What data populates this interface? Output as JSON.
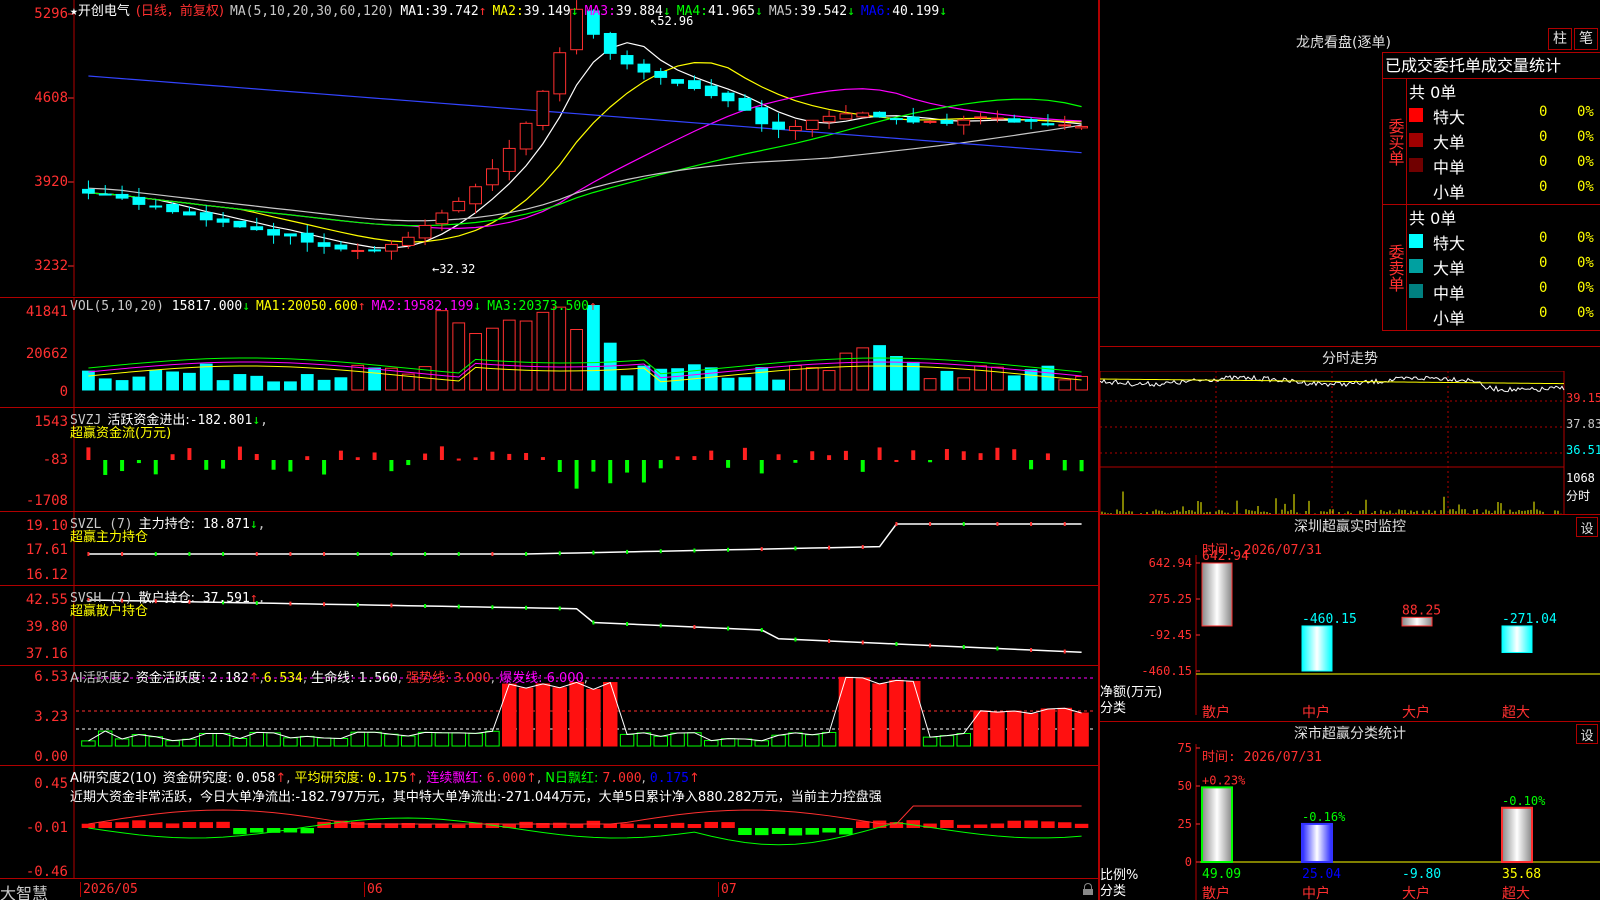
{
  "stock": {
    "star": "★",
    "name": "开创电气",
    "period": "(日线，前复权)"
  },
  "kline": {
    "ma_params": "MA(5,10,20,30,60,120)",
    "ma": [
      {
        "label": "MA1:",
        "value": "39.742",
        "arrow": "↑",
        "color": "#ffffff"
      },
      {
        "label": "MA2:",
        "value": "39.149",
        "arrow": "↓",
        "color": "#ffff00"
      },
      {
        "label": "MA3:",
        "value": "39.884",
        "arrow": "↓",
        "color": "#ff00ff"
      },
      {
        "label": "MA4:",
        "value": "41.965",
        "arrow": "↓",
        "color": "#00ff00"
      },
      {
        "label": "MA5:",
        "value": "39.542",
        "arrow": "↓",
        "color": "#c8c8c8"
      },
      {
        "label": "MA6:",
        "value": "40.199",
        "arrow": "↓",
        "color": "#0000ff"
      }
    ],
    "yaxis": [
      "5296",
      "4608",
      "3920",
      "3232"
    ],
    "high_mark": "52.96",
    "low_mark": "32.32"
  },
  "vol": {
    "title": "VOL(5,10,20)",
    "value": "15817.000",
    "arrow": "↓",
    "ma": [
      {
        "label": "MA1:",
        "value": "20050.600",
        "arrow": "↑",
        "color": "#ffff00"
      },
      {
        "label": "MA2:",
        "value": "19582.199",
        "arrow": "↓",
        "color": "#ff00ff"
      },
      {
        "label": "MA3:",
        "value": "20373.500",
        "arrow": "↑",
        "color": "#00ff00"
      }
    ],
    "yaxis": [
      "41841",
      "20662",
      "0"
    ]
  },
  "svzj": {
    "title": "SVZJ",
    "label": "活跃资金进出:",
    "value": "-182.801",
    "arrow": "↓",
    "sub": "超赢资金流(万元)",
    "yaxis": [
      "1543",
      "-83",
      "-1708"
    ]
  },
  "svzl": {
    "title": "SVZL (7)",
    "label": "主力持仓:",
    "value": "18.871",
    "arrow": "↓",
    "sub": "超赢主力持仓",
    "yaxis": [
      "19.10",
      "17.61",
      "16.12"
    ]
  },
  "svsh": {
    "title": "SVSH (7)",
    "label": "散户持仓:",
    "value": "37.591",
    "arrow": "↑",
    "sub": "超赢散户持仓",
    "yaxis": [
      "42.55",
      "39.80",
      "37.16"
    ]
  },
  "ai1": {
    "title": "AI活跃度2",
    "label": "资金活跃度:",
    "value": "2.182",
    "arrow": "↑",
    "v2": "6.534",
    "life_label": "生命线:",
    "life": "1.560",
    "strong": "强势线: 3.000",
    "burst": "爆发线: 6.000",
    "yaxis": [
      "6.53",
      "3.23",
      "0.00"
    ]
  },
  "ai2": {
    "title": "AI研究度2(10)",
    "label": "资金研究度:",
    "value": "0.058",
    "arrow": "↑",
    "avg_label": "平均研究度:",
    "avg": "0.175",
    "avg_arrow": "↑",
    "cont_label": "连续飘红:",
    "cont": "6.000",
    "cont_arrow": "↑",
    "nday_label": "N日飘红:",
    "nday": "7.000",
    "tail": "0.175",
    "tail_arrow": "↑",
    "comment": "近期大资金非常活跃，今日大单净流出:-182.797万元，其中特大单净流出:-271.044万元，大单5日累计净入880.282万元，当前主力控盘强",
    "yaxis": [
      "0.45",
      "-0.01",
      "-0.46"
    ]
  },
  "xaxis": {
    "logo": "大智慧",
    "labels": [
      "2026/05",
      "06",
      "07"
    ]
  },
  "right": {
    "lhb": {
      "title": "龙虎看盘(逐单)",
      "btn1": "柱",
      "btn2": "笔",
      "header": "已成交委托单成交量统计",
      "buy": {
        "label": "委买单",
        "total": "共 0单",
        "rows": [
          {
            "name": "特大",
            "color": "#ff0000",
            "v": "0",
            "p": "0%"
          },
          {
            "name": "大单",
            "color": "#a00000",
            "v": "0",
            "p": "0%"
          },
          {
            "name": "中单",
            "color": "#700000",
            "v": "0",
            "p": "0%"
          },
          {
            "name": "小单",
            "color": "#000000",
            "v": "0",
            "p": "0%"
          }
        ]
      },
      "sell": {
        "label": "委卖单",
        "total": "共 0单",
        "rows": [
          {
            "name": "特大",
            "color": "#00ffff",
            "v": "0",
            "p": "0%"
          },
          {
            "name": "大单",
            "color": "#00a0a0",
            "v": "0",
            "p": "0%"
          },
          {
            "name": "中单",
            "color": "#008080",
            "v": "0",
            "p": "0%"
          },
          {
            "name": "小单",
            "color": "#000000",
            "v": "0",
            "p": "0%"
          }
        ]
      }
    },
    "fenshi": {
      "title": "分时走势",
      "yaxis": [
        "39.15",
        "37.83",
        "36.51"
      ],
      "vol_top": "1068",
      "vol_unit": "分时"
    },
    "szmon": {
      "title": "深圳超赢实时监控",
      "btn": "设",
      "time": "时间: 2026/07/31",
      "yaxis": [
        "642.94",
        "275.25",
        "-92.45",
        "-460.15"
      ],
      "ylabel1": "净额(万元)",
      "ylabel2": "分类",
      "bars": [
        {
          "cat": "散户",
          "value": 642.94,
          "label": "642.94",
          "lcolor": "#ff3030"
        },
        {
          "cat": "中户",
          "value": -460.15,
          "label": "-460.15",
          "lcolor": "#00ffff"
        },
        {
          "cat": "大户",
          "value": 88.25,
          "label": "88.25",
          "lcolor": "#ff3030"
        },
        {
          "cat": "超大",
          "value": -271.04,
          "label": "-271.04",
          "lcolor": "#00ffff"
        }
      ]
    },
    "szcls": {
      "title": "深市超赢分类统计",
      "btn": "设",
      "time": "时间: 2026/07/31",
      "yaxis": [
        "75",
        "50",
        "25",
        "0"
      ],
      "ylabel1": "比例%",
      "ylabel2": "分类",
      "bars": [
        {
          "cat": "散户",
          "top": "+0.23%",
          "tcolor": "#ff3030",
          "bottom": "49.09",
          "bcolor": "#00ff00",
          "value": 49.09,
          "fill": "#ffffff"
        },
        {
          "cat": "中户",
          "top": "-0.16%",
          "tcolor": "#00ff00",
          "bottom": "25.04",
          "bcolor": "#0000ff",
          "value": 25.04,
          "fill": "#3333ff"
        },
        {
          "cat": "大户",
          "top": "",
          "tcolor": "#ff3030",
          "bottom": "-9.80",
          "bcolor": "#00ffff",
          "value": 0,
          "fill": "#ff3030"
        },
        {
          "cat": "超大",
          "top": "-0.10%",
          "tcolor": "#00ff00",
          "bottom": "35.68",
          "bcolor": "#ffff00",
          "value": 35.68,
          "fill": "#ffffff"
        }
      ]
    }
  }
}
